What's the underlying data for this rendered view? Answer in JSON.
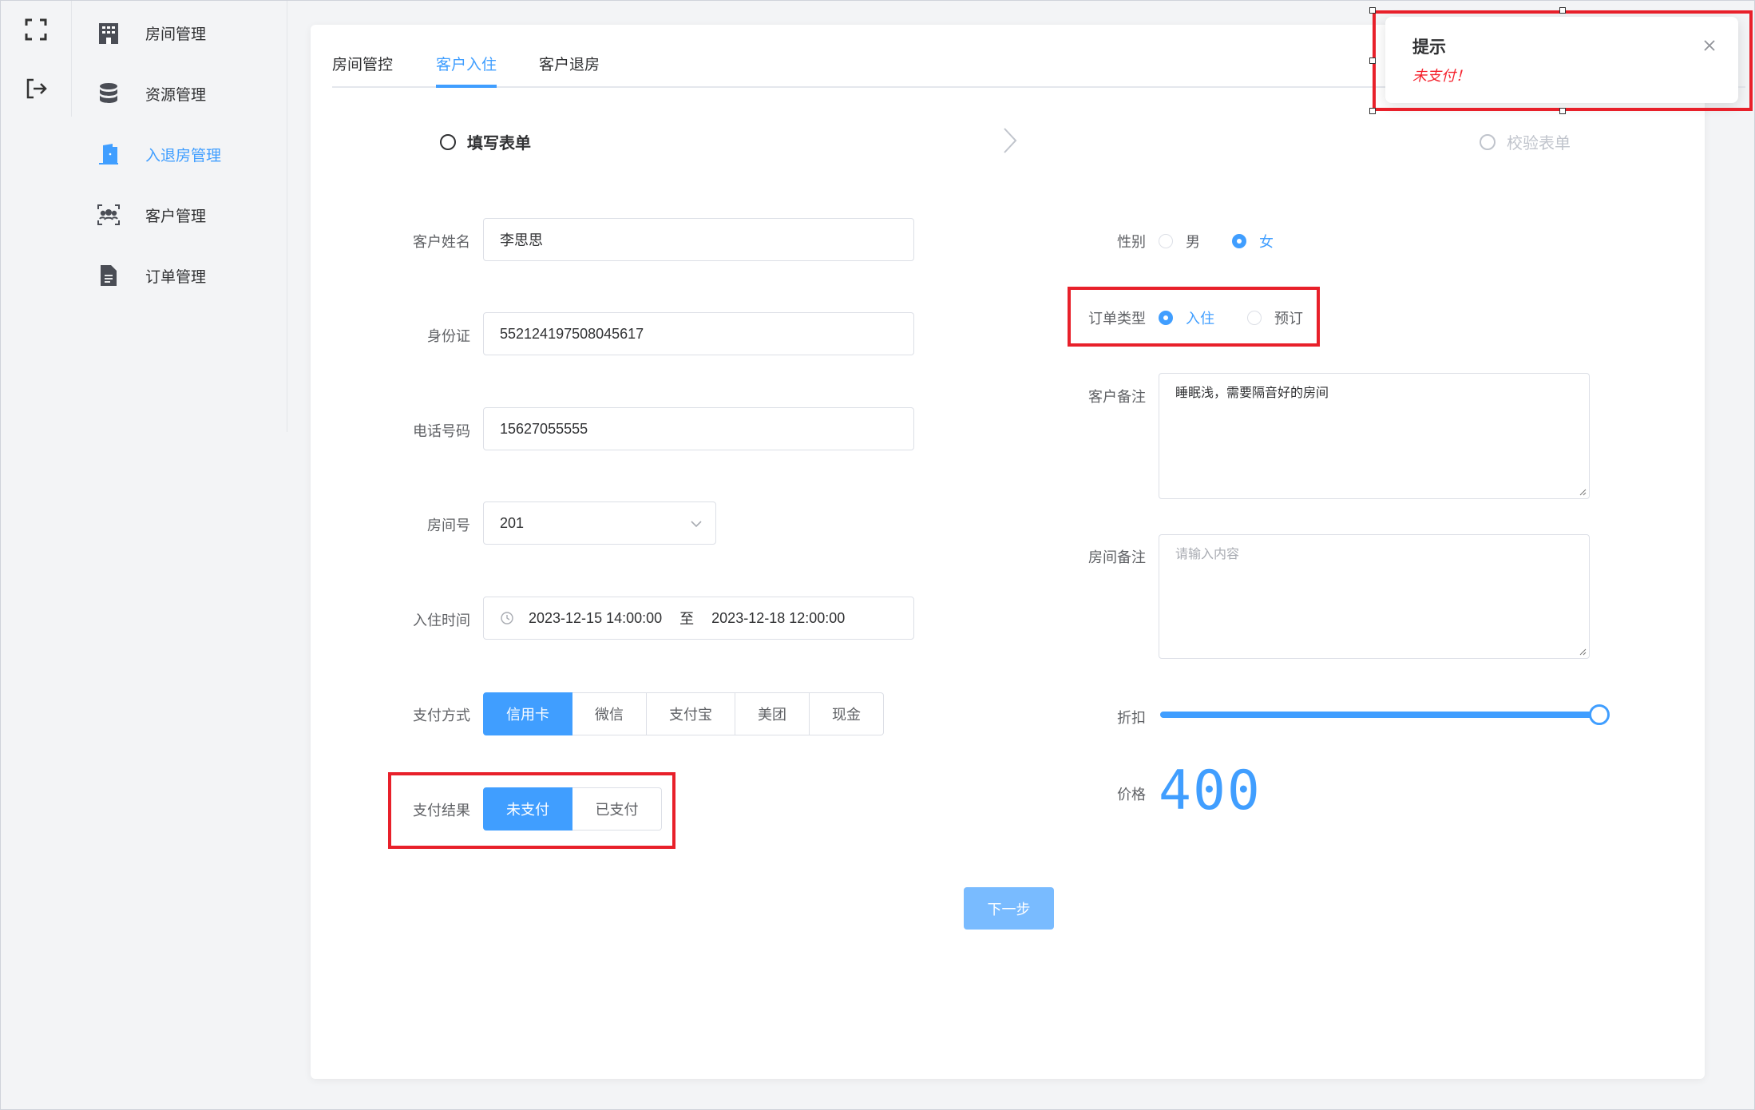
{
  "top_icons": {
    "fullscreen_icon": "fullscreen-icon",
    "logout_icon": "logout-icon"
  },
  "sidebar": {
    "items": [
      {
        "label": "房间管理",
        "icon": "building-icon",
        "active": false
      },
      {
        "label": "资源管理",
        "icon": "database-icon",
        "active": false
      },
      {
        "label": "入退房管理",
        "icon": "door-icon",
        "active": true
      },
      {
        "label": "客户管理",
        "icon": "users-icon",
        "active": false
      },
      {
        "label": "订单管理",
        "icon": "document-icon",
        "active": false
      }
    ]
  },
  "tabs": [
    {
      "label": "房间管控",
      "active": false
    },
    {
      "label": "客户入住",
      "active": true
    },
    {
      "label": "客户退房",
      "active": false
    }
  ],
  "steps": [
    {
      "label": "填写表单",
      "state": "current"
    },
    {
      "label": "校验表单",
      "state": "wait"
    }
  ],
  "form": {
    "name_label": "客户姓名",
    "name_value": "李思思",
    "id_label": "身份证",
    "id_value": "552124197508045617",
    "phone_label": "电话号码",
    "phone_value": "15627055555",
    "room_label": "房间号",
    "room_value": "201",
    "time_label": "入住时间",
    "time_start": "2023-12-15 14:00:00",
    "time_sep": "至",
    "time_end": "2023-12-18 12:00:00",
    "pay_method_label": "支付方式",
    "pay_methods": [
      {
        "label": "信用卡",
        "selected": true
      },
      {
        "label": "微信",
        "selected": false
      },
      {
        "label": "支付宝",
        "selected": false
      },
      {
        "label": "美团",
        "selected": false
      },
      {
        "label": "现金",
        "selected": false
      }
    ],
    "pay_result_label": "支付结果",
    "pay_results": [
      {
        "label": "未支付",
        "selected": true
      },
      {
        "label": "已支付",
        "selected": false
      }
    ],
    "gender_label": "性别",
    "genders": [
      {
        "label": "男",
        "selected": false
      },
      {
        "label": "女",
        "selected": true
      }
    ],
    "order_type_label": "订单类型",
    "order_types": [
      {
        "label": "入住",
        "selected": true
      },
      {
        "label": "预订",
        "selected": false
      }
    ],
    "customer_note_label": "客户备注",
    "customer_note_value": "睡眠浅，需要隔音好的房间",
    "room_note_label": "房间备注",
    "room_note_placeholder": "请输入内容",
    "discount_label": "折扣",
    "discount_value_fraction": 1.0,
    "price_label": "价格",
    "price_value": "400",
    "next_button": "下一步"
  },
  "toast": {
    "title": "提示",
    "message": "未支付！"
  },
  "colors": {
    "primary": "#409eff",
    "highlight_box": "#e8202a",
    "error": "#f5222d"
  }
}
